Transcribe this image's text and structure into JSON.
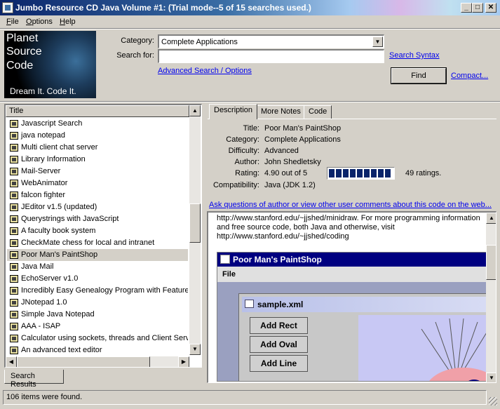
{
  "window": {
    "title": "Jumbo Resource CD Java Volume #1: (Trial mode--5 of 15 searches used.)",
    "minimize": "_",
    "maximize": "□",
    "close": "✕"
  },
  "menu": [
    "File",
    "Options",
    "Help"
  ],
  "logo": {
    "line1": "Planet",
    "line2": "Source",
    "line3": "Code",
    "tagline": "Dream It.  Code It."
  },
  "search": {
    "category_label": "Category:",
    "category_value": "Complete Applications",
    "search_for_label": "Search for:",
    "search_for_value": "",
    "search_syntax_link": "Search Syntax",
    "advanced_link": "Advanced Search / Options",
    "find_button": "Find",
    "compact_link": "Compact..."
  },
  "results": {
    "column_header": "Title",
    "items": [
      "Javascript Search",
      "java notepad",
      "Multi client chat server",
      "Library Information",
      "Mail-Server",
      "WebAnimator",
      "falcon fighter",
      "JEditor v1.5 (updated)",
      "Querystrings with JavaScript",
      "A faculty book system",
      "CheckMate chess for local and intranet",
      "Poor Man's PaintShop",
      "Java Mail",
      "EchoServer v1.0",
      "Incredibly Easy Genealogy Program with Features",
      "JNotepad 1.0",
      "Simple Java Notepad",
      "AAA - ISAP",
      "Calculator using sockets, threads and Client Server",
      "An advanced text editor"
    ],
    "selected_index": 11,
    "bottom_tab": "Search Results"
  },
  "detail": {
    "tabs": [
      "Description",
      "More Notes",
      "Code"
    ],
    "active_tab": 0,
    "fields": {
      "title_label": "Title:",
      "title": "Poor Man's PaintShop",
      "category_label": "Category:",
      "category": "Complete Applications",
      "difficulty_label": "Difficulty:",
      "difficulty": "Advanced",
      "author_label": "Author:",
      "author": "John Shedletsky",
      "rating_label": "Rating:",
      "rating": "4.90 out of 5",
      "rating_fraction": 0.98,
      "ratings_count": "49 ratings.",
      "compatibility_label": "Compatibility:",
      "compatibility": "Java (JDK 1.2)"
    },
    "comments_link": "Ask questions of author or view other user comments about this code on the web...",
    "preview": {
      "line1": "http://www.stanford.edu/~jjshed/minidraw. For more programming information",
      "line2": "and free source code, both Java and otherwise, visit",
      "line3": "http://www.stanford.edu/~jjshed/coding",
      "app_title": "Poor Man's PaintShop",
      "app_menu": "File",
      "inner_title": "sample.xml",
      "buttons": [
        "Add Rect",
        "Add Oval",
        "Add Line"
      ]
    }
  },
  "status": {
    "text": "106 items were found."
  },
  "colors": {
    "title_bar_start": "#0a246a",
    "face": "#d4d0c8",
    "link": "#0000ee",
    "rating_fill": "#0a246a"
  }
}
